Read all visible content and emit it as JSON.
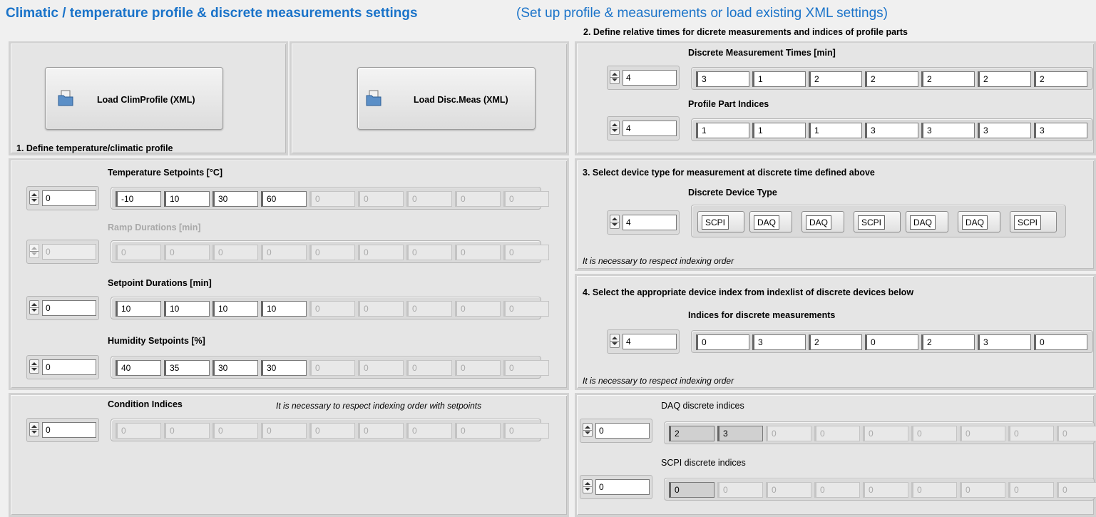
{
  "header": {
    "title": "Climatic / temperature profile & discrete measurements settings",
    "subtitle": "(Set up profile & measurements or load existing XML settings)"
  },
  "load_panel": {
    "load_clim_label": "Load ClimProfile (XML)",
    "load_disc_label": "Load Disc.Meas (XML)",
    "step1_label": "1. Define temperature/climatic profile"
  },
  "profile": {
    "temperature": {
      "label": "Temperature Setpoints [°C]",
      "index": "0",
      "values": [
        "-10",
        "10",
        "30",
        "60",
        "0",
        "0",
        "0",
        "0",
        "0"
      ]
    },
    "ramp": {
      "label": "Ramp Durations [min]",
      "index": "0",
      "values": [
        "0",
        "0",
        "0",
        "0",
        "0",
        "0",
        "0",
        "0",
        "0"
      ]
    },
    "setpoint": {
      "label": "Setpoint Durations [min]",
      "index": "0",
      "values": [
        "10",
        "10",
        "10",
        "10",
        "0",
        "0",
        "0",
        "0",
        "0"
      ]
    },
    "humidity": {
      "label": "Humidity Setpoints [%]",
      "index": "0",
      "values": [
        "40",
        "35",
        "30",
        "30",
        "0",
        "0",
        "0",
        "0",
        "0"
      ]
    }
  },
  "condition": {
    "label": "Condition Indices",
    "note": "It is necessary to respect indexing order with setpoints",
    "index": "0",
    "values": [
      "0",
      "0",
      "0",
      "0",
      "0",
      "0",
      "0",
      "0",
      "0"
    ]
  },
  "times": {
    "step2_label": "2. Define relative times for dicrete measurements and indices of profile parts",
    "disc_times": {
      "label": "Discrete Measurement Times [min]",
      "index": "4",
      "values": [
        "3",
        "1",
        "2",
        "2",
        "2",
        "2",
        "2"
      ]
    },
    "part_indices": {
      "label": "Profile Part Indices",
      "index": "4",
      "values": [
        "1",
        "1",
        "1",
        "3",
        "3",
        "3",
        "3"
      ]
    }
  },
  "device_type": {
    "step3_label": "3. Select device type for measurement at discrete time defined above",
    "label": "Discrete Device Type",
    "index": "4",
    "values": [
      "SCPI",
      "DAQ",
      "DAQ",
      "SCPI",
      "DAQ",
      "DAQ",
      "SCPI"
    ],
    "note": "It is necessary to respect indexing order"
  },
  "device_index": {
    "step4_label": "4. Select the appropriate device index from indexlist of discrete devices below",
    "label": "Indices for discrete measurements",
    "index": "4",
    "values": [
      "0",
      "3",
      "2",
      "0",
      "2",
      "3",
      "0"
    ],
    "note": "It is necessary to respect indexing order"
  },
  "daq": {
    "label": "DAQ discrete indices",
    "index": "0",
    "values": [
      "2",
      "3",
      "0",
      "0",
      "0",
      "0",
      "0",
      "0",
      "0"
    ]
  },
  "scpi": {
    "label": "SCPI discrete indices",
    "index": "0",
    "values": [
      "0",
      "0",
      "0",
      "0",
      "0",
      "0",
      "0",
      "0",
      "0"
    ]
  }
}
